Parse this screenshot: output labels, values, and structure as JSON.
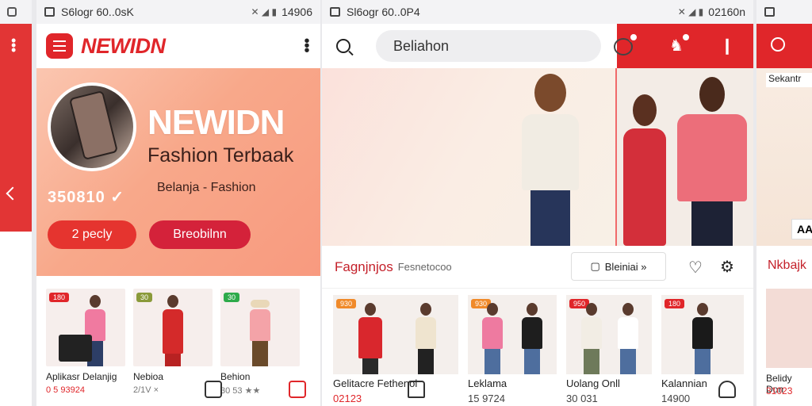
{
  "colors": {
    "accent": "#e0262a",
    "hero_peach": "#f8a88a",
    "banner_cream": "#faede4"
  },
  "left_sliver": {
    "icons": [
      "square-icon",
      "kebab-icon",
      "chevron-icon"
    ]
  },
  "phone1": {
    "status": {
      "left": "S6logr 60..0sK",
      "right": "14906"
    },
    "brand": "NEWIDN",
    "hero": {
      "title": "NEWIDN",
      "subtitle": "Fashion Terbaak",
      "tagline": "Belanja - Fashion",
      "count": "350810 ✓"
    },
    "buttons": {
      "primary": "2 pecly",
      "secondary": "Breobilnn"
    },
    "products": [
      {
        "badge": "180",
        "name": "Aplikasr Delanjig",
        "price": "0 5 93924"
      },
      {
        "badge": "30",
        "name": "Nebioa",
        "price": "2/1V ×"
      },
      {
        "badge": "30",
        "name": "Behion",
        "price": "30 53 ★★"
      }
    ]
  },
  "phone2": {
    "status": {
      "left": "Sl6ogr 60..0P4",
      "right": "02160n"
    },
    "search": {
      "value": "Beliahon"
    },
    "section": {
      "title": "Fagnjnjos",
      "subtitle": "Fesnetocoo"
    },
    "filter_label": "Bleiniai »",
    "products": [
      {
        "badge": "930",
        "name": "Gelitacre Fethenol",
        "price": "02123"
      },
      {
        "badge": "",
        "name": "",
        "price": ""
      },
      {
        "badge": "930",
        "name": "Leklama",
        "price": "15 9724"
      },
      {
        "badge": "",
        "name": "",
        "price": ""
      },
      {
        "badge": "950",
        "name": "Uolang Onll",
        "price": "30 031"
      },
      {
        "badge": "180",
        "name": "Kalannian",
        "price": "14900"
      }
    ]
  },
  "phone3": {
    "chip": "Sekantr",
    "badge": "AA",
    "title": "Nkbajk",
    "product_name": "Belidy Don",
    "product_price": "31023"
  }
}
